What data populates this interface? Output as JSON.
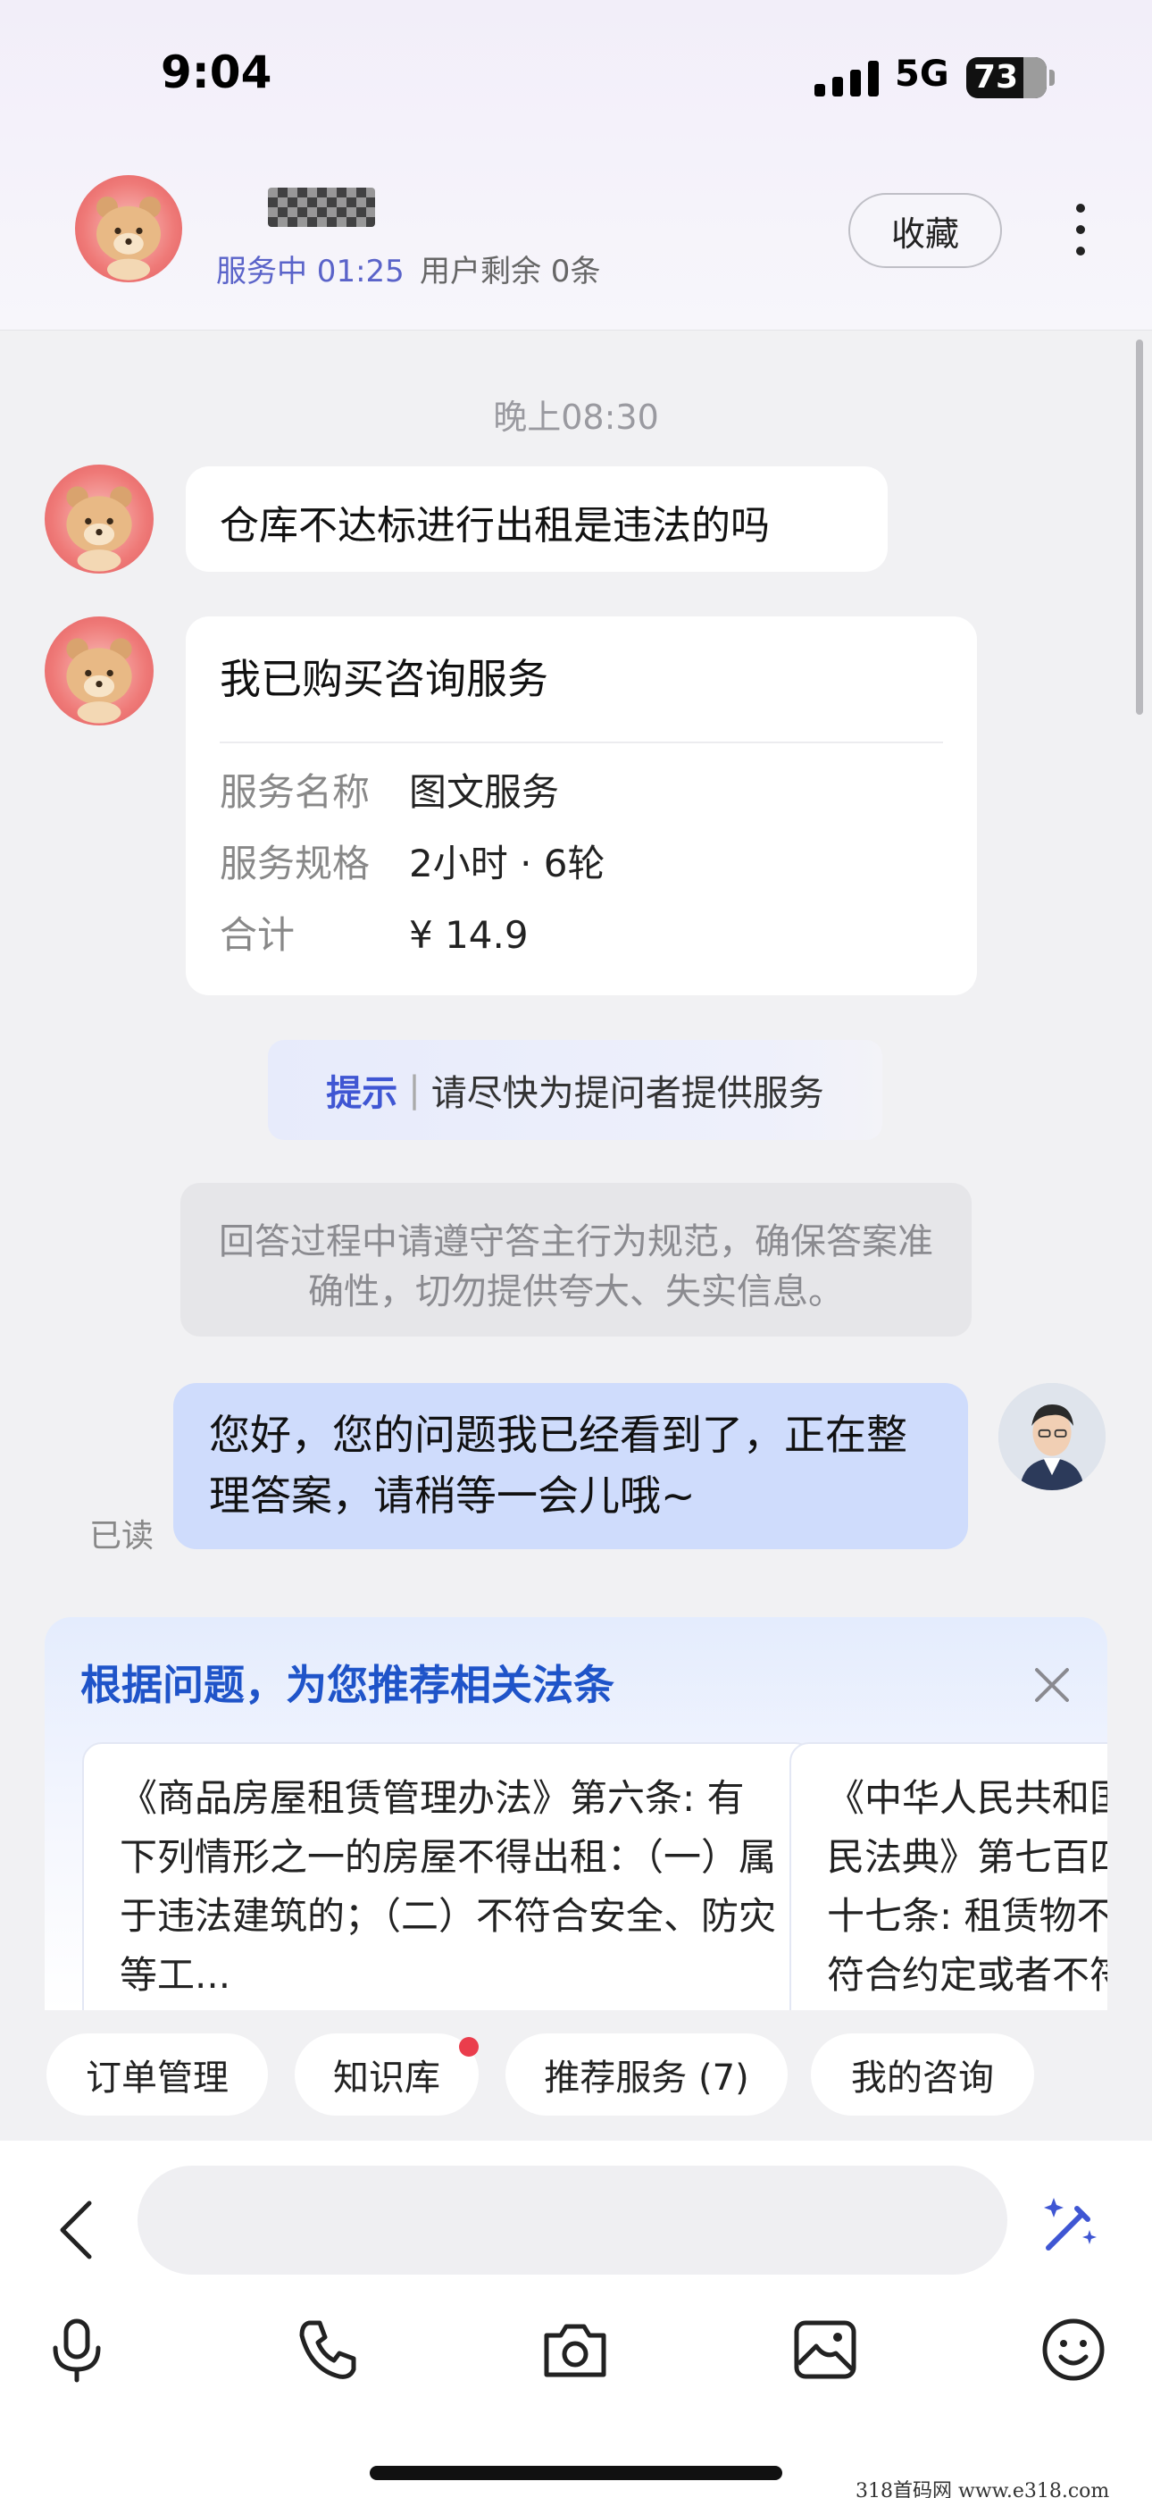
{
  "status_bar": {
    "time": "9:04",
    "network": "5G",
    "battery": "73"
  },
  "header": {
    "status": "服务中 01:25",
    "remaining": "用户剩余 0条",
    "favorite_label": "收藏",
    "more_icon": "more-vertical-icon"
  },
  "chat": {
    "timestamp": "晚上08:30",
    "question": "仓库不达标进行出租是违法的吗",
    "service_card": {
      "title": "我已购买咨询服务",
      "rows": [
        {
          "key": "服务名称",
          "value": "图文服务"
        },
        {
          "key": "服务规格",
          "value": "2小时 · 6轮"
        },
        {
          "key": "合计",
          "value": "¥ 14.9"
        }
      ]
    },
    "tip": {
      "label": "提示",
      "text": "请尽快为提问者提供服务"
    },
    "rule_notice": "回答过程中请遵守答主行为规范，确保答案准确性，切勿提供夸大、失实信息。",
    "reply": "您好，您的问题我已经看到了，正在整理答案，请稍等一会儿哦~",
    "read_status": "已读"
  },
  "recommendation": {
    "title": "根据问题，为您推荐相关法条",
    "laws": [
      {
        "text": "《商品房屋租赁管理办法》第六条: 有下列情形之一的房屋不得出租：（一）属于违法建筑的；（二）不符合安全、防灾等工..."
      },
      {
        "text": "《中华人民共和国民法典》第七百四十七条: 租赁物不符合约定或者不符合使用目的的，出租人不承担责任。但..."
      }
    ]
  },
  "quick_actions": [
    {
      "label": "订单管理"
    },
    {
      "label": "知识库",
      "badge": true
    },
    {
      "label": "推荐服务 (7)"
    },
    {
      "label": "我的咨询"
    }
  ],
  "input": {
    "placeholder": ""
  },
  "toolbar": [
    "microphone-icon",
    "phone-icon",
    "camera-icon",
    "image-icon",
    "emoji-icon"
  ],
  "watermark": "318首码网  www.e318.com",
  "colors": {
    "accent_blue": "#3f56d3",
    "reply_bubble": "#cfdcfc",
    "badge_red": "#ea3d4c",
    "status_purple": "#5a63c9"
  }
}
